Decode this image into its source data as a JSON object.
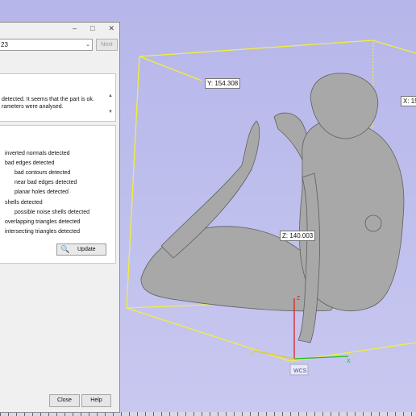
{
  "panel": {
    "combo_value": "23",
    "combo_arrow": "chevron-down-icon",
    "next_label": "Next",
    "message_lines": [
      "detected. It seems that the part is ok.",
      "rameters were analysed."
    ],
    "checks": [
      {
        "label": "inverted normals detected",
        "indent": 0
      },
      {
        "label": "bad edges detected",
        "indent": 0
      },
      {
        "label": "bad contours detected",
        "indent": 1
      },
      {
        "label": "near bad edges detected",
        "indent": 1
      },
      {
        "label": "planar holes detected",
        "indent": 1
      },
      {
        "label": "shells detected",
        "indent": 0
      },
      {
        "label": "possible noise shells detected",
        "indent": 1
      },
      {
        "label": "overlapping triangles detected",
        "indent": 0
      },
      {
        "label": "intersecting triangles detected",
        "indent": 0
      }
    ],
    "update_label": "Update",
    "update_icon": "magnifier-icon",
    "close_label": "Close",
    "help_label": "Help"
  },
  "viewport": {
    "dims": {
      "y": "Y: 154.308",
      "x": "X: 15",
      "z": "Z: 140.003"
    },
    "axis_labels": {
      "x": "X",
      "y": "Y",
      "z": "Z"
    },
    "coord_label": "WCS",
    "colors": {
      "bbox": "#f2ef3c",
      "x_axis": "#22bb22",
      "y_axis": "#dccc22",
      "z_axis": "#dd2222",
      "model": "#a8a8a8"
    }
  }
}
